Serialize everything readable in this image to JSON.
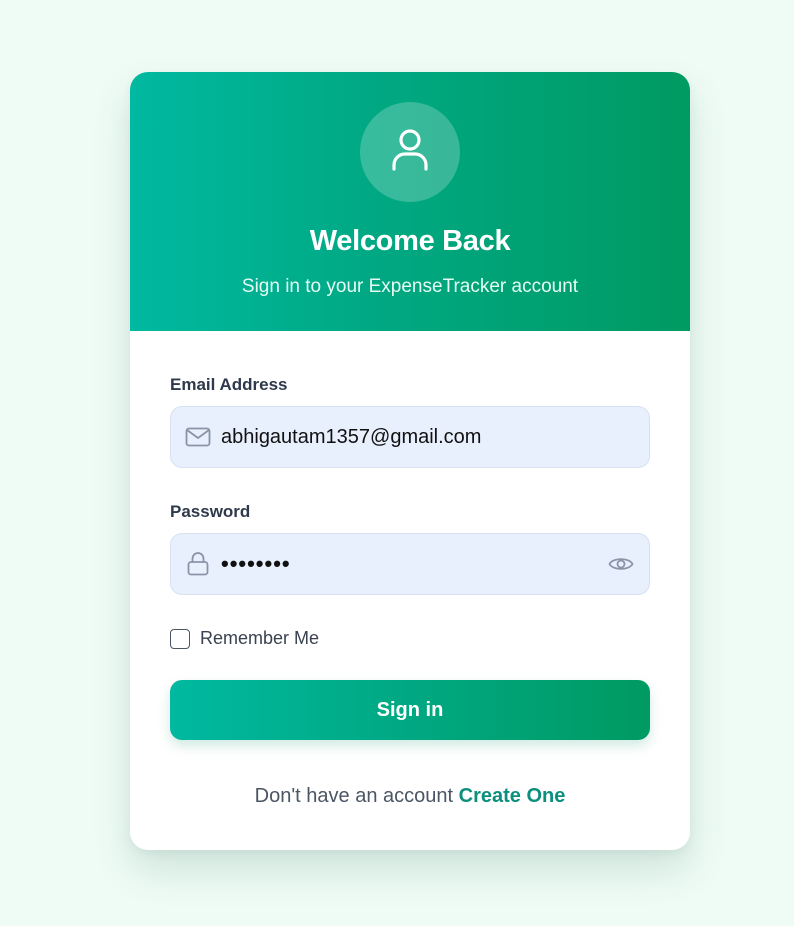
{
  "header": {
    "title": "Welcome Back",
    "subtitle": "Sign in to your ExpenseTracker account",
    "avatar_icon": "user-icon"
  },
  "form": {
    "email": {
      "label": "Email Address",
      "value": "abhigautam1357@gmail.com",
      "icon": "mail-icon"
    },
    "password": {
      "label": "Password",
      "value": "••••••••",
      "icon": "lock-icon",
      "toggle_icon": "eye-icon"
    },
    "remember_label": "Remember Me",
    "remember_checked": false,
    "submit_label": "Sign in"
  },
  "footer": {
    "text": "Don't have an account",
    "link": "Create One"
  },
  "colors": {
    "page_bg": "#effcf6",
    "gradient_start": "#00b9a0",
    "gradient_end": "#009a62",
    "input_bg": "#e8f0fe",
    "link": "#0c8f7d"
  }
}
